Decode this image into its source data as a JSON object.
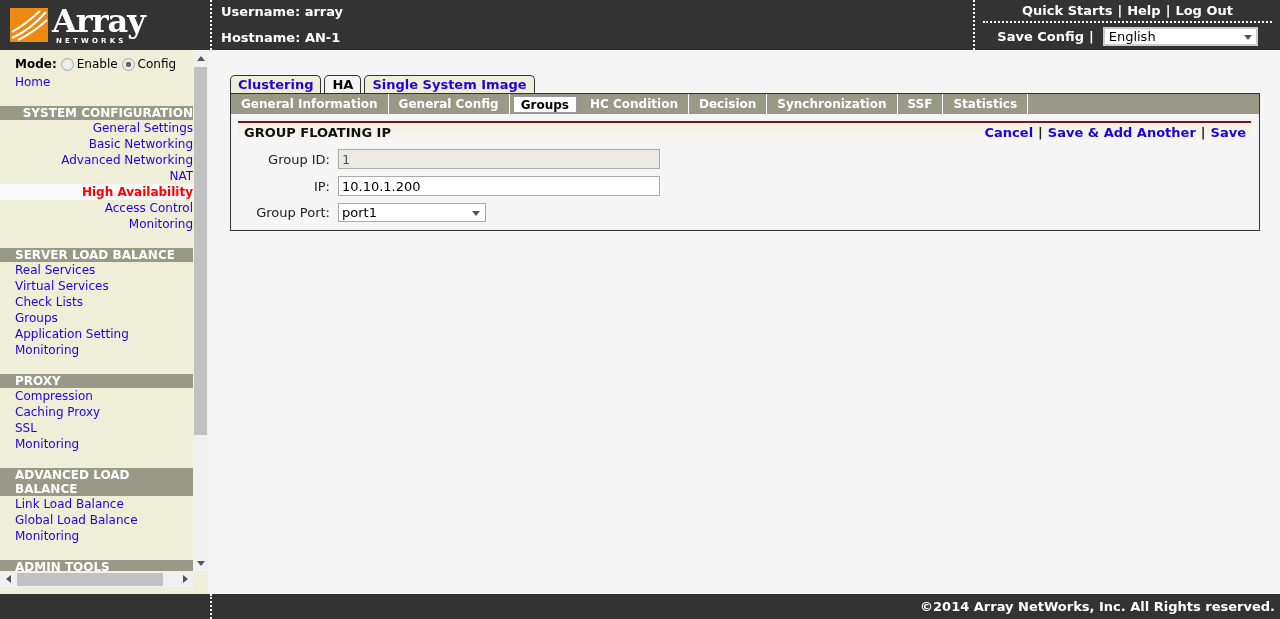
{
  "header": {
    "logo": {
      "name": "Array",
      "tagline": "NETWORKS"
    },
    "user": {
      "username": "Username: array",
      "hostname": "Hostname: AN-1"
    },
    "top_links": [
      {
        "label": "Quick Starts"
      },
      {
        "label": "Help"
      },
      {
        "label": "Log Out"
      }
    ],
    "separator": "|",
    "save_config": "Save Config",
    "language": {
      "value": "English"
    }
  },
  "sidebar": {
    "mode": {
      "label": "Mode:",
      "options": [
        {
          "label": "Enable",
          "selected": false
        },
        {
          "label": "Config",
          "selected": true
        }
      ]
    },
    "home": "Home",
    "sections": [
      {
        "title": "SYSTEM CONFIGURATION",
        "kind": "right",
        "items": [
          {
            "label": "General Settings",
            "selected": false
          },
          {
            "label": "Basic Networking",
            "selected": false
          },
          {
            "label": "Advanced Networking",
            "selected": false
          },
          {
            "label": "NAT",
            "selected": false
          },
          {
            "label": "High Availability",
            "selected": true
          },
          {
            "label": "Access Control",
            "selected": false
          },
          {
            "label": "Monitoring",
            "selected": false
          }
        ]
      },
      {
        "title": "SERVER LOAD BALANCE",
        "kind": "left",
        "items": [
          {
            "label": "Real Services",
            "selected": false
          },
          {
            "label": "Virtual Services",
            "selected": false
          },
          {
            "label": "Check Lists",
            "selected": false
          },
          {
            "label": "Groups",
            "selected": false
          },
          {
            "label": "Application Setting",
            "selected": false
          },
          {
            "label": "Monitoring",
            "selected": false
          }
        ]
      },
      {
        "title": "PROXY",
        "kind": "left",
        "items": [
          {
            "label": "Compression",
            "selected": false
          },
          {
            "label": "Caching Proxy",
            "selected": false
          },
          {
            "label": "SSL",
            "selected": false
          },
          {
            "label": "Monitoring",
            "selected": false
          }
        ]
      },
      {
        "title": "ADVANCED LOAD BALANCE",
        "kind": "left",
        "items": [
          {
            "label": "Link Load Balance",
            "selected": false
          },
          {
            "label": "Global Load Balance",
            "selected": false
          },
          {
            "label": "Monitoring",
            "selected": false
          }
        ]
      },
      {
        "title": "ADMIN TOOLS",
        "kind": "left"
      }
    ]
  },
  "tabs": [
    {
      "label": "Clustering",
      "selected": false
    },
    {
      "label": "HA",
      "selected": true
    },
    {
      "label": "Single System Image",
      "selected": false
    }
  ],
  "subtabs": [
    {
      "label": "General Information",
      "selected": false
    },
    {
      "label": "General Config",
      "selected": false
    },
    {
      "label": "Groups",
      "selected": true
    },
    {
      "label": "HC Condition",
      "selected": false
    },
    {
      "label": "Decision",
      "selected": false
    },
    {
      "label": "Synchronization",
      "selected": false
    },
    {
      "label": "SSF",
      "selected": false
    },
    {
      "label": "Statistics",
      "selected": false
    }
  ],
  "panel": {
    "title": "GROUP FLOATING IP",
    "actions": [
      {
        "label": "Cancel"
      },
      {
        "label": "Save & Add Another"
      },
      {
        "label": "Save"
      }
    ],
    "separator": "|",
    "fields": [
      {
        "kind": "text",
        "label": "Group ID:",
        "value": "1",
        "disabled": true
      },
      {
        "kind": "text",
        "label": "IP:",
        "value": "10.10.1.200",
        "disabled": false
      },
      {
        "kind": "select",
        "label": "Group Port:",
        "value": "port1",
        "disabled": false
      }
    ]
  },
  "footer": {
    "copyright": "©2014 Array NetWorks, Inc. All Rights reserved."
  }
}
